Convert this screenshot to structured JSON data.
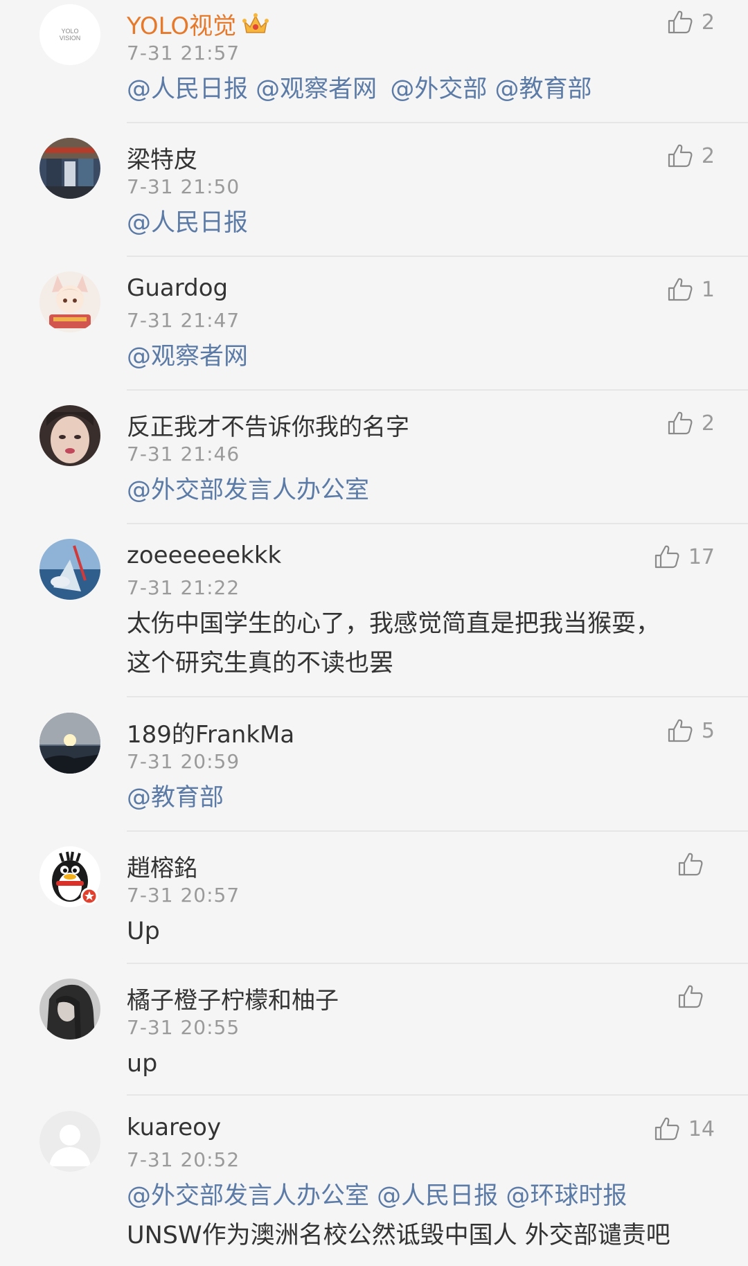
{
  "colors": {
    "background": "#f5f5f5",
    "username": "#333333",
    "vip_username": "#e5792c",
    "mention": "#5b7ba6",
    "meta": "#9a9a9a",
    "divider": "#e6e6e6"
  },
  "comments": [
    {
      "username": "YOLO视觉",
      "avatar_text": [
        "YOLO",
        "VISION"
      ],
      "badge_icon": "crown-icon",
      "time": "7-31 21:57",
      "likes": "2",
      "mentions": [
        "@人民日报",
        "@观察者网",
        "@外交部",
        "@教育部"
      ]
    },
    {
      "username": "梁特皮",
      "time": "7-31 21:50",
      "likes": "2",
      "mentions": [
        "@人民日报"
      ]
    },
    {
      "username": "Guardog",
      "time": "7-31 21:47",
      "likes": "1",
      "mentions": [
        "@观察者网"
      ]
    },
    {
      "username": "反正我才不告诉你我的名字",
      "time": "7-31 21:46",
      "likes": "2",
      "mentions": [
        "@外交部发言人办公室"
      ]
    },
    {
      "username": "zoeeeeeekkk",
      "time": "7-31 21:22",
      "likes": "17",
      "text_lines": [
        "太伤中国学生的心了，我感觉简直是把我当猴耍，",
        "这个研究生真的不读也罢"
      ]
    },
    {
      "username": "189的FrankMa",
      "time": "7-31 20:59",
      "likes": "5",
      "mentions": [
        "@教育部"
      ]
    },
    {
      "username": "趙榕銘",
      "time": "7-31 20:57",
      "likes": "",
      "text_lines": [
        "Up"
      ]
    },
    {
      "username": "橘子橙子柠檬和柚子",
      "time": "7-31 20:55",
      "likes": "",
      "text_lines": [
        "up"
      ]
    },
    {
      "username": "kuareoy",
      "time": "7-31 20:52",
      "likes": "14",
      "mentions": [
        "@外交部发言人办公室",
        "@人民日报",
        "@环球时报"
      ],
      "text_lines": [
        "UNSW作为澳洲名校公然诋毁中国人 外交部谴责吧"
      ]
    }
  ]
}
